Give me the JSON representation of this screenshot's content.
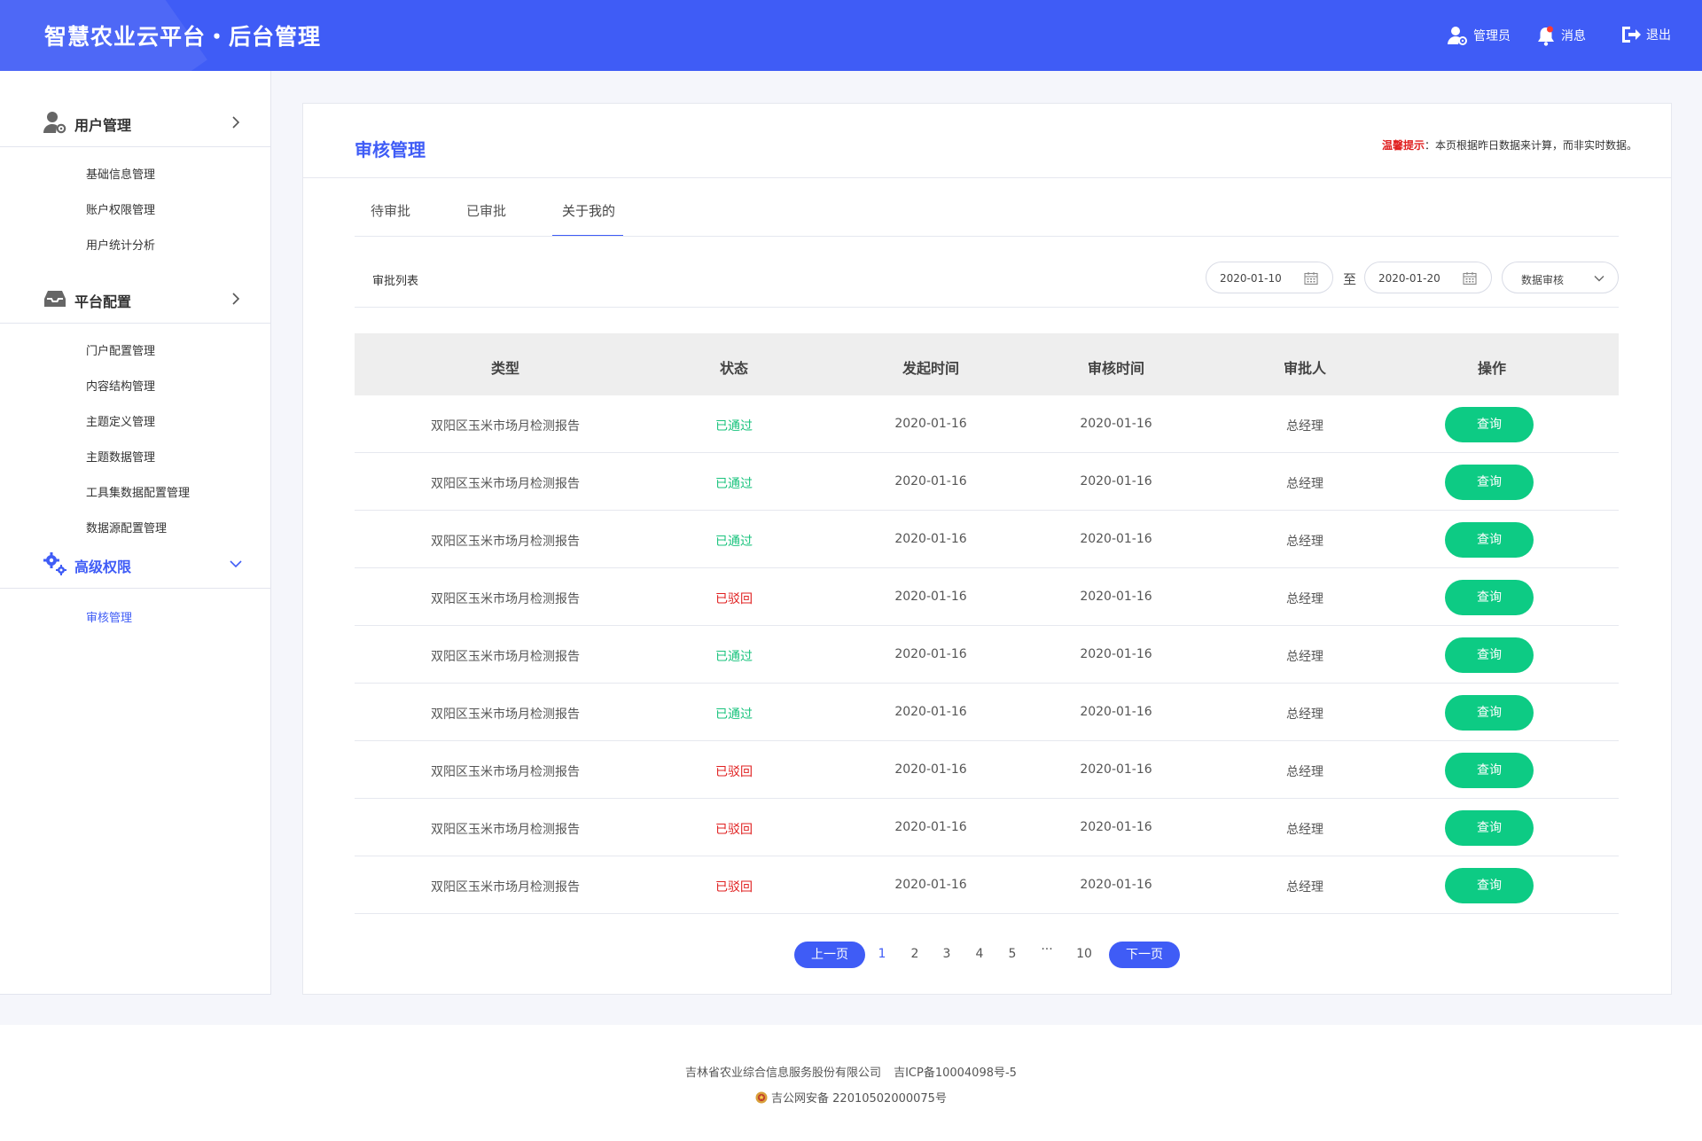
{
  "header": {
    "title": "智慧农业云平台・后台管理",
    "admin_label": "管理员",
    "message_label": "消息",
    "logout_label": "退出"
  },
  "sidebar": {
    "groups": [
      {
        "label": "用户管理",
        "icon": "user-gear-icon",
        "items": [
          "基础信息管理",
          "账户权限管理",
          "用户统计分析"
        ]
      },
      {
        "label": "平台配置",
        "icon": "inbox-tray-icon",
        "items": [
          "门户配置管理",
          "内容结构管理",
          "主题定义管理",
          "主题数据管理",
          "工具集数据配置管理",
          "数据源配置管理"
        ]
      },
      {
        "label": "高级权限",
        "icon": "gears-icon",
        "items": [
          "审核管理"
        ],
        "active": true
      }
    ],
    "active_item": "审核管理"
  },
  "main": {
    "title": "审核管理",
    "tip_label": "温馨提示",
    "tip_text": "：本页根据昨日数据来计算，而非实时数据。",
    "tabs": [
      "待审批",
      "已审批",
      "关于我的"
    ],
    "active_tab": "关于我的",
    "list_label": "审批列表",
    "filters": {
      "start_date": "2020-01-10",
      "to_label": "至",
      "end_date": "2020-01-20",
      "type_select": "数据审核"
    },
    "table": {
      "headers": [
        "类型",
        "状态",
        "发起时间",
        "审核时间",
        "审批人",
        "操作"
      ],
      "rows": [
        {
          "type": "双阳区玉米市场月检测报告",
          "status": "已通过",
          "start": "2020-01-16",
          "review": "2020-01-16",
          "approver": "总经理",
          "action": "查询"
        },
        {
          "type": "双阳区玉米市场月检测报告",
          "status": "已通过",
          "start": "2020-01-16",
          "review": "2020-01-16",
          "approver": "总经理",
          "action": "查询"
        },
        {
          "type": "双阳区玉米市场月检测报告",
          "status": "已通过",
          "start": "2020-01-16",
          "review": "2020-01-16",
          "approver": "总经理",
          "action": "查询"
        },
        {
          "type": "双阳区玉米市场月检测报告",
          "status": "已驳回",
          "start": "2020-01-16",
          "review": "2020-01-16",
          "approver": "总经理",
          "action": "查询"
        },
        {
          "type": "双阳区玉米市场月检测报告",
          "status": "已通过",
          "start": "2020-01-16",
          "review": "2020-01-16",
          "approver": "总经理",
          "action": "查询"
        },
        {
          "type": "双阳区玉米市场月检测报告",
          "status": "已通过",
          "start": "2020-01-16",
          "review": "2020-01-16",
          "approver": "总经理",
          "action": "查询"
        },
        {
          "type": "双阳区玉米市场月检测报告",
          "status": "已驳回",
          "start": "2020-01-16",
          "review": "2020-01-16",
          "approver": "总经理",
          "action": "查询"
        },
        {
          "type": "双阳区玉米市场月检测报告",
          "status": "已驳回",
          "start": "2020-01-16",
          "review": "2020-01-16",
          "approver": "总经理",
          "action": "查询"
        },
        {
          "type": "双阳区玉米市场月检测报告",
          "status": "已驳回",
          "start": "2020-01-16",
          "review": "2020-01-16",
          "approver": "总经理",
          "action": "查询"
        }
      ]
    },
    "pagination": {
      "prev_label": "上一页",
      "next_label": "下一页",
      "pages": [
        "1",
        "2",
        "3",
        "4",
        "5",
        "···",
        "10"
      ],
      "current": "1"
    }
  },
  "footer": {
    "company": "吉林省农业综合信息服务股份有限公司",
    "icp": "吉ICP备10004098号-5",
    "police": "吉公网安备 22010502000075号"
  },
  "colors": {
    "brand": "#3f5cf6",
    "approved": "#19c37d",
    "rejected": "#e02020",
    "query_button": "#0dcb84"
  }
}
